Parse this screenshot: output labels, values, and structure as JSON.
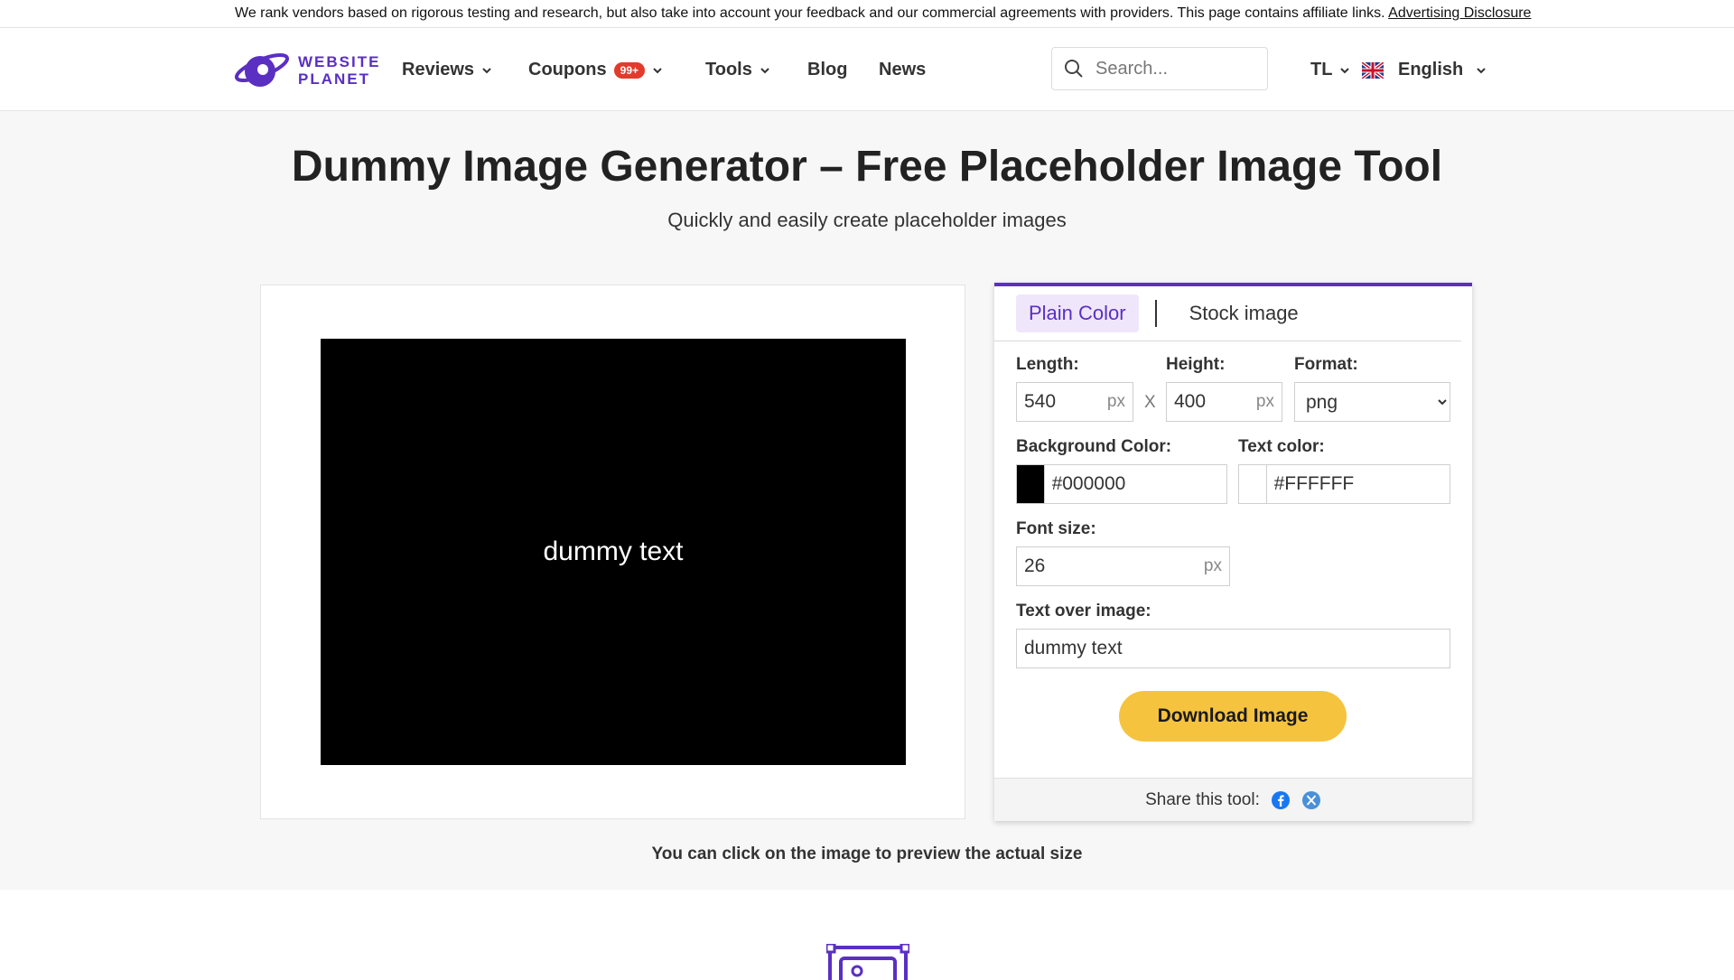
{
  "topbar": {
    "disclosure_text": "We rank vendors based on rigorous testing and research, but also take into account your feedback and our commercial agreements with providers. This page contains affiliate links.",
    "disclosure_link": "Advertising Disclosure"
  },
  "logo": {
    "line1": "WEBSITE",
    "line2": "PLANET"
  },
  "nav": {
    "reviews": "Reviews",
    "coupons": "Coupons",
    "coupons_badge": "99+",
    "tools": "Tools",
    "blog": "Blog",
    "news": "News",
    "search_placeholder": "Search...",
    "region": "TL",
    "language": "English"
  },
  "page": {
    "title": "Dummy Image Generator – Free Placeholder Image Tool",
    "subtitle": "Quickly and easily create placeholder images",
    "preview_hint": "You can click on the image to preview the actual size"
  },
  "preview": {
    "text": "dummy text",
    "background": "#000000",
    "text_color": "#FFFFFF"
  },
  "tool": {
    "tabs": [
      "Plain Color",
      "Stock image"
    ],
    "length_label": "Length:",
    "length_value": "540",
    "height_label": "Height:",
    "height_value": "400",
    "unit": "px",
    "times": "X",
    "format_label": "Format:",
    "format_value": "png",
    "bg_label": "Background Color:",
    "bg_value": "#000000",
    "text_color_label": "Text color:",
    "text_color_value": "#FFFFFF",
    "font_size_label": "Font size:",
    "font_size_value": "26",
    "text_over_label": "Text over image:",
    "text_over_value": "dummy text",
    "download_label": "Download Image",
    "share_label": "Share this tool:"
  },
  "colors": {
    "brand": "#5a2fc2",
    "download": "#f6c33f",
    "badge": "#e23a2b"
  },
  "icons": [
    "planet-logo-icon",
    "chevron-down-icon",
    "search-icon",
    "uk-flag-icon",
    "facebook-icon",
    "x-icon",
    "image-frame-icon"
  ]
}
